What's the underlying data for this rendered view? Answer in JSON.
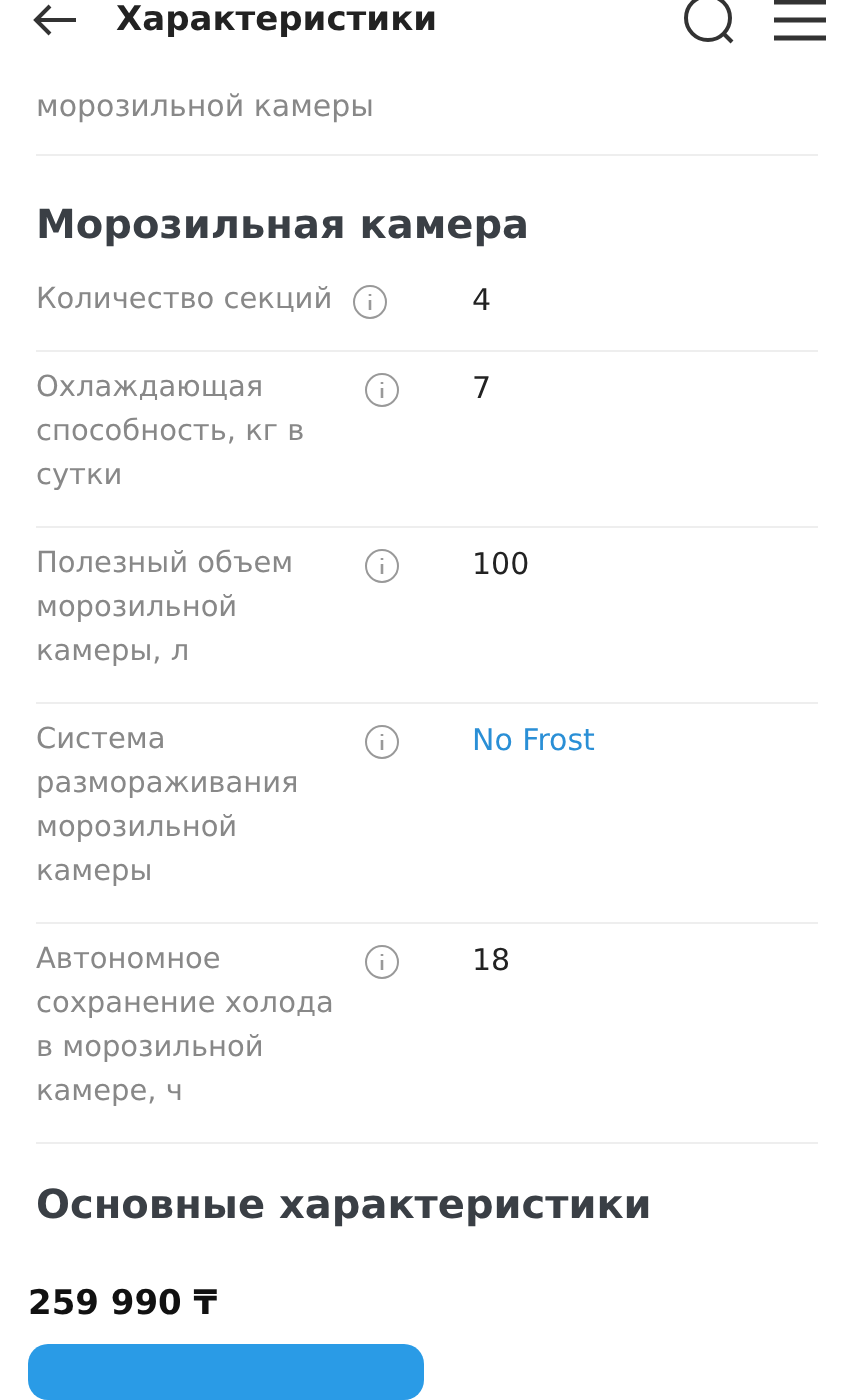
{
  "header": {
    "title": "Характеристики"
  },
  "previous_tail": "морозильной камеры",
  "section": {
    "title": "Морозильная камера",
    "rows": [
      {
        "label": "Количество секций",
        "value": "4",
        "kind": "text"
      },
      {
        "label": "Охлаждающая способность, кг в сутки",
        "value": "7",
        "kind": "text"
      },
      {
        "label": "Полезный объем морозильной камеры, л",
        "value": "100",
        "kind": "text"
      },
      {
        "label": "Система размораживания морозильной камеры",
        "value": "No Frost",
        "kind": "link"
      },
      {
        "label": "Автономное сохранение холода в морозильной камере, ч",
        "value": "18",
        "kind": "text"
      }
    ]
  },
  "next_section": {
    "title": "Основные характеристики"
  },
  "price": "259 990 ₸",
  "bottom_button": {
    "kind": "primary"
  }
}
